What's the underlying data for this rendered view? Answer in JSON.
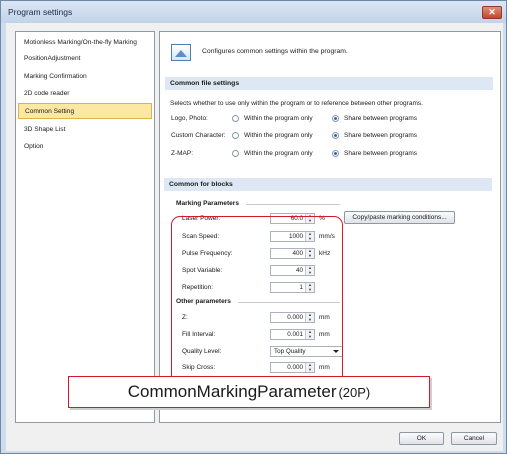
{
  "window": {
    "title": "Program settings"
  },
  "nav": {
    "items": [
      "Motionless Marking/On-the-fly Marking",
      "PositionAdjustment",
      "Marking Confirmation",
      "2D code reader",
      "Common Setting",
      "3D Shape List",
      "Option"
    ],
    "selected": "Common Setting"
  },
  "header": {
    "description": "Configures common settings within the program."
  },
  "file_settings": {
    "title": "Common file settings",
    "description": "Selects whether to use only within the program or to reference between other programs.",
    "option_a": "Within the program only",
    "option_b": "Share between programs",
    "rows": [
      {
        "label": "Logo, Photo:",
        "selected": "Share between programs"
      },
      {
        "label": "Custom Character:",
        "selected": "Share between programs"
      },
      {
        "label": "Z-MAP:",
        "selected": "Share between programs"
      }
    ]
  },
  "blocks": {
    "title": "Common for blocks",
    "marking": {
      "title": "Marking Parameters",
      "laser_power": {
        "label": "Laser Power:",
        "value": "60.0",
        "unit": "%"
      },
      "scan_speed": {
        "label": "Scan Speed:",
        "value": "1000",
        "unit": "mm/s"
      },
      "pulse_frequency": {
        "label": "Pulse Frequency:",
        "value": "400",
        "unit": "kHz"
      },
      "spot_variable": {
        "label": "Spot Variable:",
        "value": "40"
      },
      "repetition": {
        "label": "Repetition:",
        "value": "1"
      },
      "copy_button": "Copy/paste marking conditions..."
    },
    "other": {
      "title": "Other parameters",
      "z": {
        "label": "Z:",
        "value": "0.000",
        "unit": "mm"
      },
      "fill_interval": {
        "label": "Fill Interval:",
        "value": "0.001",
        "unit": "mm"
      },
      "quality_level": {
        "label": "Quality Level:",
        "value": "Top Quality"
      },
      "skip_cross": {
        "label": "Skip Cross:",
        "value": "0.000",
        "unit": "mm"
      }
    }
  },
  "callout": {
    "main": "CommonMarkingParameter",
    "sub": "(20P)"
  },
  "footer": {
    "ok": "OK",
    "cancel": "Cancel"
  },
  "colors": {
    "highlight_red": "#d4192c",
    "selected_item": "#fce7a3",
    "section_band": "#dde8f4"
  }
}
